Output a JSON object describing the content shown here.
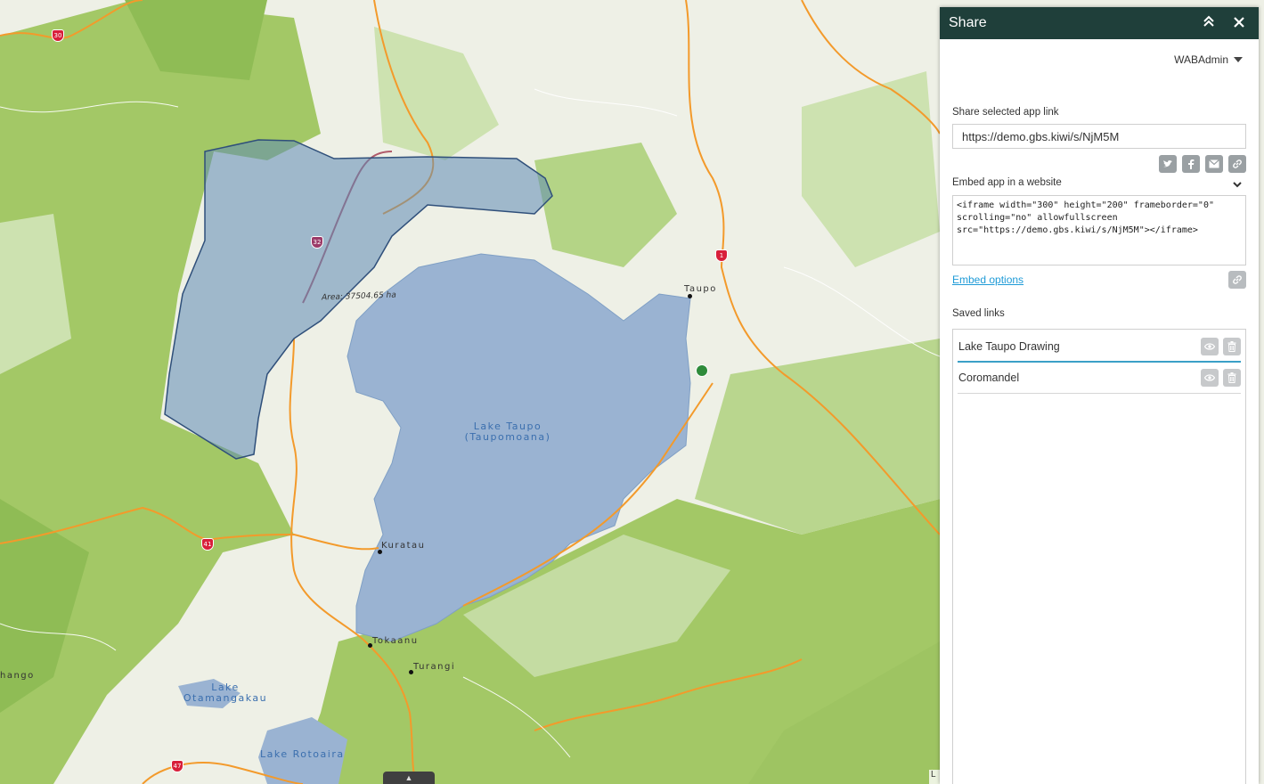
{
  "panel": {
    "title": "Share",
    "user": "WABAdmin",
    "share_link_label": "Share selected app link",
    "share_link_value": "https://demo.gbs.kiwi/s/NjM5M",
    "social_icons": [
      "twitter-icon",
      "facebook-icon",
      "email-icon",
      "link-icon"
    ],
    "embed_label": "Embed app in a website",
    "embed_code": "<iframe width=\"300\" height=\"200\" frameborder=\"0\" scrolling=\"no\" allowfullscreen src=\"https://demo.gbs.kiwi/s/NjM5M\"></iframe>",
    "embed_options_label": "Embed options",
    "saved_links_label": "Saved links",
    "saved_links": [
      {
        "name": "Lake Taupo Drawing"
      },
      {
        "name": "Coromandel"
      }
    ]
  },
  "map": {
    "lake_taupo_label_1": "Lake Taupo",
    "lake_taupo_label_2": "(Taupomoana)",
    "area_label": "Area: 37504.65 ha",
    "places": {
      "taupo": "Taupo",
      "kuratau": "Kuratau",
      "tokaanu": "Tokaanu",
      "turangi": "Turangi",
      "hango": "hango",
      "otamangakau_1": "Lake",
      "otamangakau_2": "Otamangakau",
      "rotoaira": "Lake Rotoaira"
    },
    "shields": {
      "sh30": "30",
      "sh32": "32",
      "sh1": "1",
      "sh41": "41",
      "sh47": "47"
    },
    "attribution": "L"
  },
  "colors": {
    "header": "#1f3f3a",
    "link": "#1f9bd7",
    "water": "#9ab3d2",
    "forest": "#a3c866",
    "polygon_fill": "#5f8ab5",
    "road": "#f39a2b"
  }
}
